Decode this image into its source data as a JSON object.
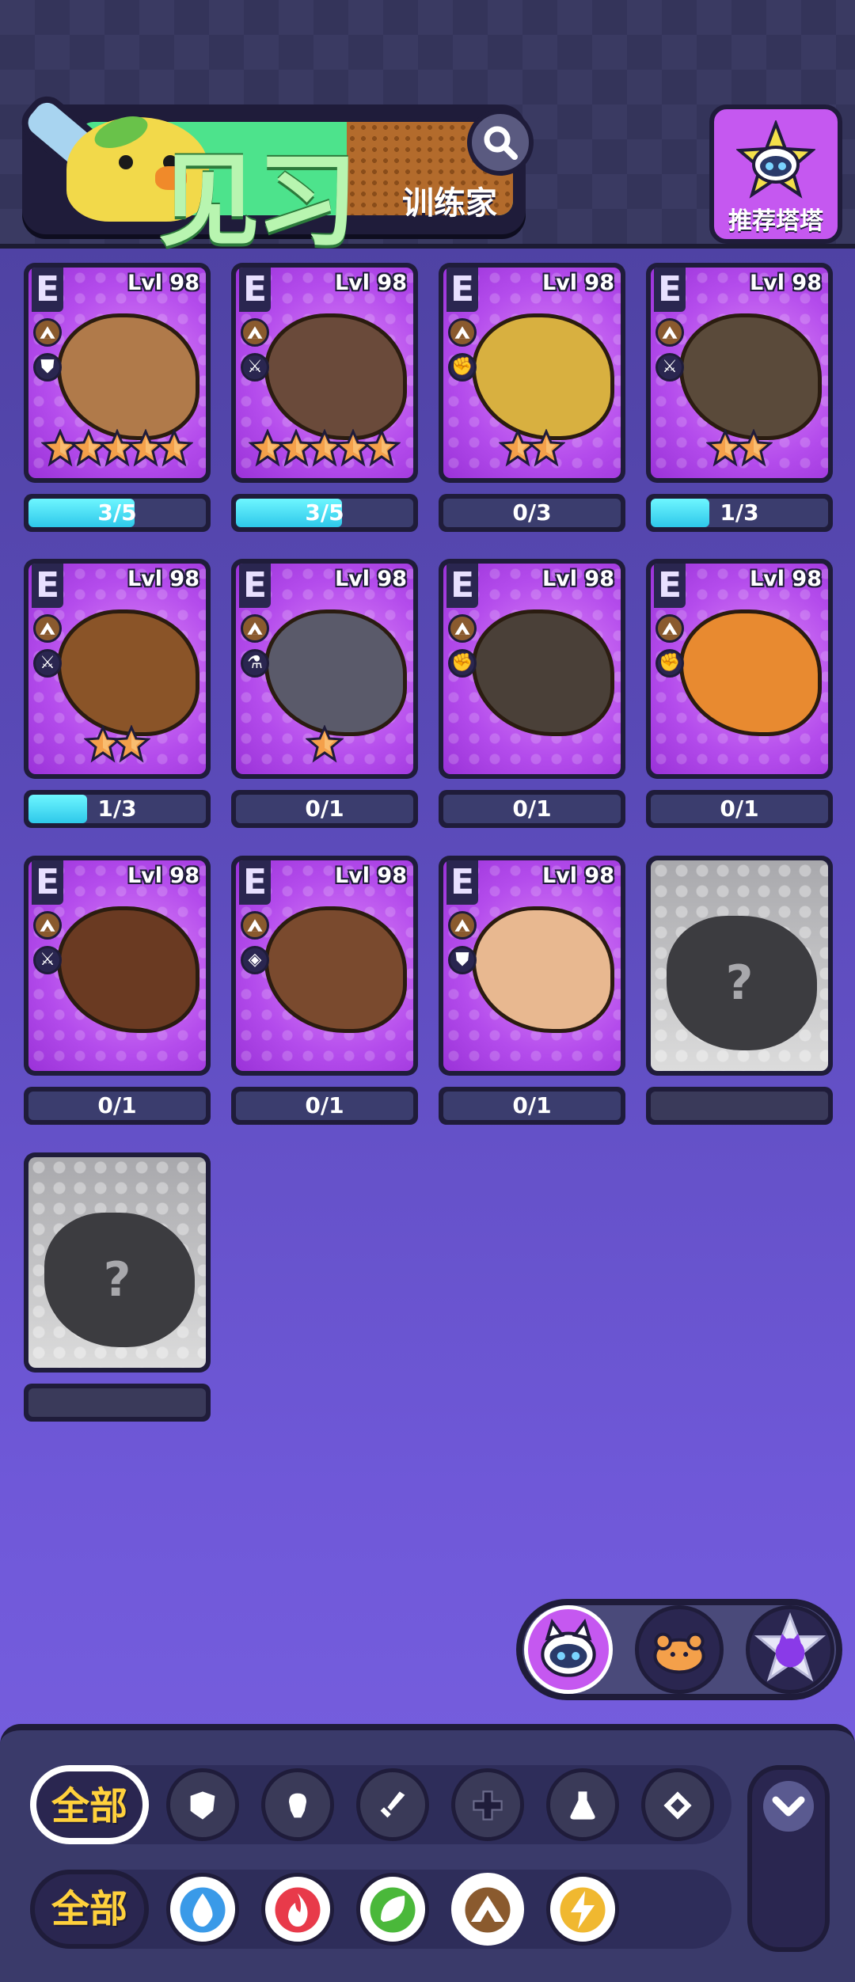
{
  "header": {
    "title": "见习",
    "subtitle": "训练家",
    "recommend_label": "推荐塔塔"
  },
  "cards": [
    {
      "rank": "E",
      "level": "Lvl 98",
      "stars": 5,
      "progress": "3/5",
      "progress_fraction": 0.6,
      "element_icon": "earth-icon",
      "role_icon": "shield-icon",
      "color": "#b07a4a"
    },
    {
      "rank": "E",
      "level": "Lvl 98",
      "stars": 5,
      "progress": "3/5",
      "progress_fraction": 0.6,
      "element_icon": "earth-icon",
      "role_icon": "sword-icon",
      "color": "#6a4a3a"
    },
    {
      "rank": "E",
      "level": "Lvl 98",
      "stars": 2,
      "progress": "0/3",
      "progress_fraction": 0,
      "element_icon": "earth-icon",
      "role_icon": "fist-icon",
      "color": "#d8b040"
    },
    {
      "rank": "E",
      "level": "Lvl 98",
      "stars": 2,
      "progress": "1/3",
      "progress_fraction": 0.33,
      "element_icon": "earth-icon",
      "role_icon": "sword-icon",
      "color": "#5a4a3a"
    },
    {
      "rank": "E",
      "level": "Lvl 98",
      "stars": 2,
      "progress": "1/3",
      "progress_fraction": 0.33,
      "element_icon": "earth-icon",
      "role_icon": "sword-icon",
      "color": "#8a5428"
    },
    {
      "rank": "E",
      "level": "Lvl 98",
      "stars": 1,
      "progress": "0/1",
      "progress_fraction": 0,
      "element_icon": "earth-icon",
      "role_icon": "flask-icon",
      "color": "#5a5a6a"
    },
    {
      "rank": "E",
      "level": "Lvl 98",
      "stars": 0,
      "progress": "0/1",
      "progress_fraction": 0,
      "element_icon": "earth-icon",
      "role_icon": "fist-icon",
      "color": "#4a4038"
    },
    {
      "rank": "E",
      "level": "Lvl 98",
      "stars": 0,
      "progress": "0/1",
      "progress_fraction": 0,
      "element_icon": "earth-icon",
      "role_icon": "fist-icon",
      "color": "#e88a30"
    },
    {
      "rank": "E",
      "level": "Lvl 98",
      "stars": 0,
      "progress": "0/1",
      "progress_fraction": 0,
      "element_icon": "earth-icon",
      "role_icon": "sword-icon",
      "color": "#6a3a22"
    },
    {
      "rank": "E",
      "level": "Lvl 98",
      "stars": 0,
      "progress": "0/1",
      "progress_fraction": 0,
      "element_icon": "earth-icon",
      "role_icon": "diamond-icon",
      "color": "#7a4a2e"
    },
    {
      "rank": "E",
      "level": "Lvl 98",
      "stars": 0,
      "progress": "0/1",
      "progress_fraction": 0,
      "element_icon": "earth-icon",
      "role_icon": "shield-icon",
      "color": "#e8b890"
    }
  ],
  "locked_cards": [
    {
      "mark": "?"
    },
    {
      "mark": "?"
    }
  ],
  "switcher": {
    "options": [
      "robot-cat-icon",
      "bread-icon",
      "star-cat-icon"
    ],
    "selected": 0
  },
  "filters": {
    "role_row": {
      "all_label": "全部",
      "icons": [
        "shield-icon",
        "fist-icon",
        "sword-icon",
        "plus-icon",
        "flask-icon",
        "diamond-icon"
      ],
      "selected": "all"
    },
    "element_row": {
      "all_label": "全部",
      "icons": [
        {
          "name": "water-icon",
          "color": "#3a9ae8"
        },
        {
          "name": "fire-icon",
          "color": "#e83a4a"
        },
        {
          "name": "grass-icon",
          "color": "#4ab83a"
        },
        {
          "name": "earth-icon",
          "color": "#8a5a2e"
        },
        {
          "name": "electric-icon",
          "color": "#f0b830"
        }
      ],
      "selected": "earth-icon"
    }
  },
  "colors": {
    "card_purple": "#b44cec",
    "progress_cyan": "#2ec8ea",
    "star_orange": "#f4a04a",
    "title_green": "#4de38c",
    "all_yellow": "#ffd13c"
  }
}
